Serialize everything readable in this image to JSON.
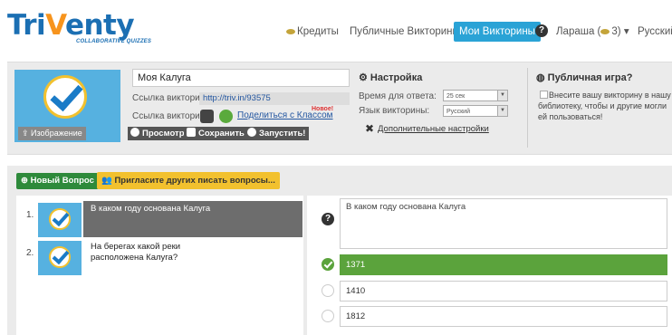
{
  "header": {
    "logo_main": "Tri",
    "logo_accent": "V",
    "logo_rest": "enty",
    "logo_tagline": "COLLABORATIVE QUIZZES",
    "nav_credits": "Кредиты",
    "nav_public": "Публичные Викторины",
    "nav_mine": "Мои Викторины",
    "nav_help": "?",
    "user_name": "Лараша",
    "user_coins": "3",
    "lang": "Русский"
  },
  "quiz": {
    "title": "Моя Калуга",
    "link_label": "Ссылка викторины:",
    "link_value": "http://triv.in/93575",
    "share_label": "Ссылка викторины:",
    "share_text": "Поделиться с Классом",
    "new_badge": "Новое!",
    "image_button": "Изображение",
    "btn_preview": "Просмотр",
    "btn_save": "Сохранить",
    "btn_launch": "Запустить!"
  },
  "settings": {
    "heading": "Настройка",
    "time_label": "Время для ответа:",
    "time_value": "25 сек",
    "lang_label": "Язык викторины:",
    "lang_value": "Русский",
    "advanced": "Дополнительные настройки"
  },
  "public_game": {
    "heading": "Публичная игра?",
    "text": "Внесите вашу викторину в нашу библиотеку, чтобы и другие могли ей пользоваться!"
  },
  "toolbar": {
    "new_question": "Новый Вопрос",
    "invite": "Пригласите других писать вопросы..."
  },
  "questions": [
    {
      "num": "1.",
      "text": "В каком году основана Калуга"
    },
    {
      "num": "2.",
      "text": "На берегах какой реки расположена Калуга?"
    }
  ],
  "editor": {
    "help": "?",
    "question_text": "В каком году основана Калуга",
    "answers": [
      "1371",
      "1410",
      "1812"
    ],
    "correct_index": 0
  },
  "colors": {
    "accent_blue": "#2aa3d6",
    "correct_green": "#5ba33c",
    "new_button_green": "#2e8a3b",
    "invite_yellow": "#f2c12e"
  }
}
